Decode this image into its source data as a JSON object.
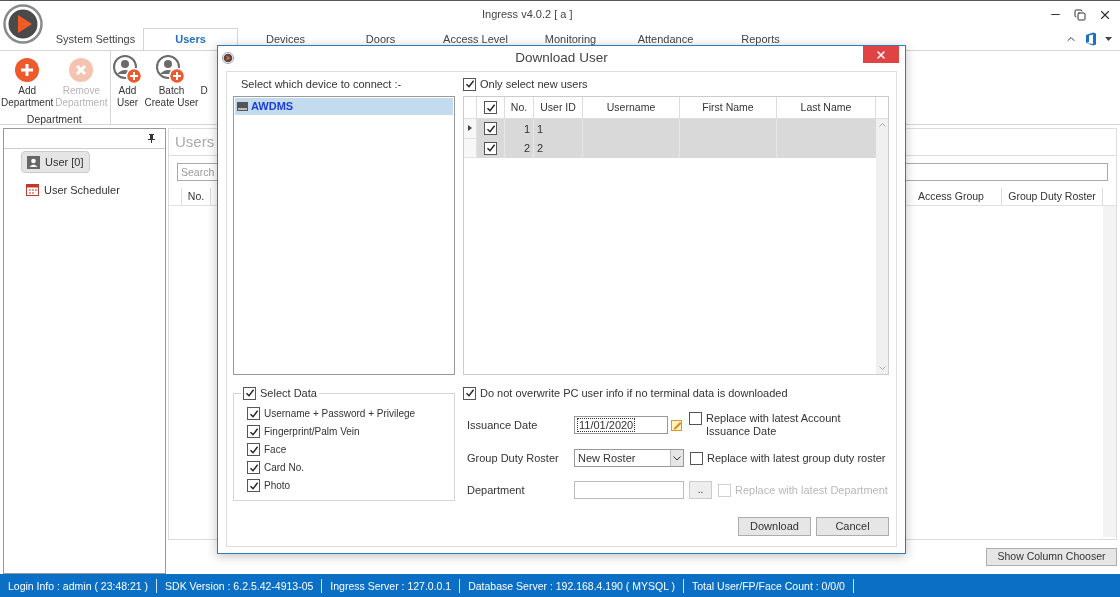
{
  "window": {
    "title": "Ingress v4.0.2 [ a ]"
  },
  "tabs": [
    {
      "label": "System Settings",
      "selected": false
    },
    {
      "label": "Users",
      "selected": true
    },
    {
      "label": "Devices",
      "selected": false
    },
    {
      "label": "Doors",
      "selected": false
    },
    {
      "label": "Access Level",
      "selected": false
    },
    {
      "label": "Monitoring",
      "selected": false
    },
    {
      "label": "Attendance",
      "selected": false
    },
    {
      "label": "Reports",
      "selected": false
    }
  ],
  "ribbon": {
    "groups": [
      {
        "label": "Department",
        "items": [
          {
            "kind": "add",
            "label": "Add\nDepartment",
            "disabled": false
          },
          {
            "kind": "remove",
            "label": "Remove\nDepartment",
            "disabled": true
          }
        ]
      },
      {
        "items": [
          {
            "kind": "add-user",
            "label": "Add\nUser",
            "disabled": false
          },
          {
            "kind": "add-user",
            "label": "Batch\nCreate User",
            "disabled": false
          },
          {
            "kind": "hidden",
            "label": "D",
            "disabled": false
          }
        ]
      }
    ]
  },
  "sidebar": {
    "items": [
      {
        "kind": "user",
        "label": "User [0]",
        "selected": true
      },
      {
        "kind": "calendar",
        "label": "User Scheduler",
        "selected": false
      }
    ]
  },
  "users_panel": {
    "title": "Users",
    "search": {
      "placeholder": "Search"
    },
    "columns": [
      "No.",
      "Access Group",
      "Group Duty Roster"
    ],
    "button": "Show Column Chooser"
  },
  "status_bar": [
    "Login Info : admin ( 23:48:21 )",
    "SDK Version : 6.2.5.42-4913-05",
    "Ingress Server : 127.0.0.1",
    "Database Server : 192.168.4.190 ( MYSQL )",
    "Total User/FP/Face Count : 0/0/0"
  ],
  "dialog": {
    "title": "Download User",
    "device_prompt": "Select which device to connect :-",
    "devices": [
      {
        "label": "AWDMS",
        "selected": true
      }
    ],
    "select_data": {
      "label": "Select Data",
      "checked": true,
      "options": [
        {
          "label": "Username + Password + Privilege",
          "checked": true
        },
        {
          "label": "Fingerprint/Palm Vein",
          "checked": true
        },
        {
          "label": "Face",
          "checked": true
        },
        {
          "label": "Card No.",
          "checked": true
        },
        {
          "label": "Photo",
          "checked": true
        }
      ]
    },
    "only_new": {
      "label": "Only select new users",
      "checked": true
    },
    "grid": {
      "header_checked": true,
      "columns": [
        "No.",
        "User ID",
        "Username",
        "First Name",
        "Last Name"
      ],
      "rows": [
        {
          "no": "1",
          "user_id": "1",
          "checked": true,
          "selected": true,
          "current": true
        },
        {
          "no": "2",
          "user_id": "2",
          "checked": true,
          "selected": true,
          "current": false
        }
      ]
    },
    "no_overwrite": {
      "label": "Do not overwrite PC user info if no terminal data is downloaded",
      "checked": true
    },
    "issuance": {
      "label": "Issuance Date",
      "value": "11/01/2020",
      "replace": {
        "label": "Replace with latest Account Issuance Date",
        "checked": false,
        "disabled": false
      }
    },
    "roster": {
      "label": "Group Duty Roster",
      "value": "New Roster",
      "replace": {
        "label": "Replace with latest group duty roster",
        "checked": false,
        "disabled": false
      }
    },
    "department": {
      "label": "Department",
      "browse": "..",
      "replace": {
        "label": "Replace with latest Department",
        "checked": false,
        "disabled": true
      }
    },
    "buttons": [
      "Download",
      "Cancel"
    ]
  }
}
